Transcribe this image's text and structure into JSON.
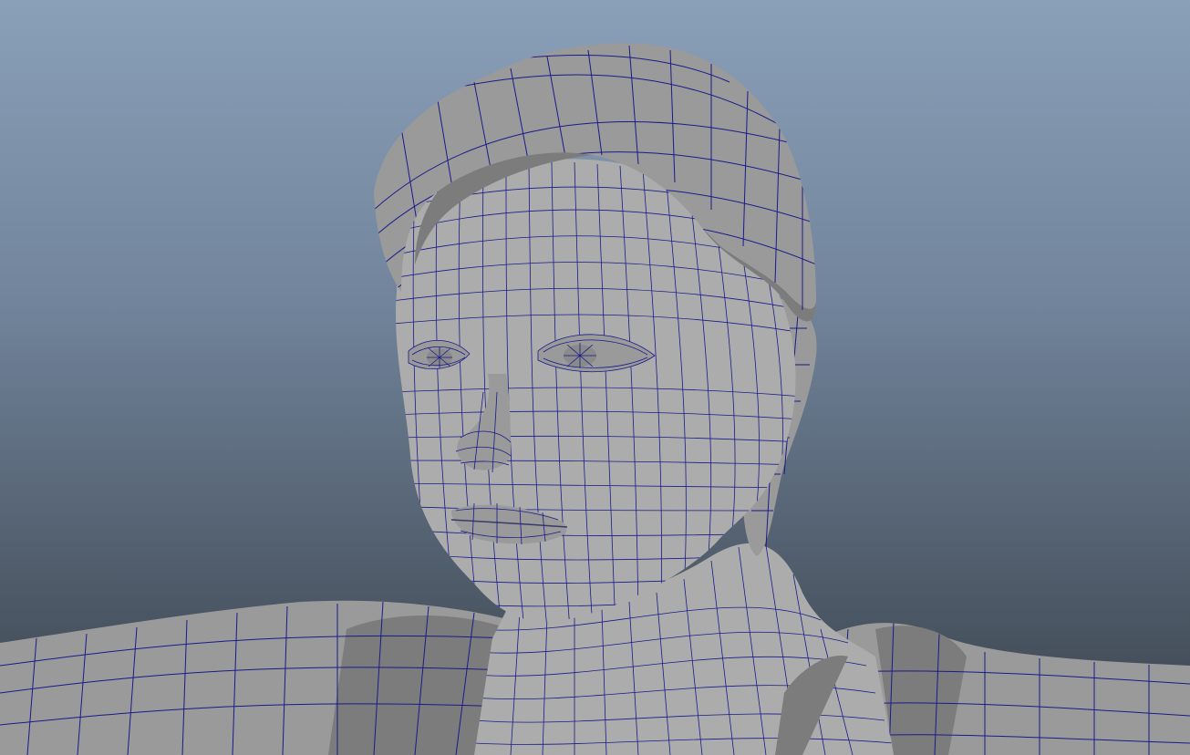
{
  "viewport": {
    "kind": "3d-perspective-viewport",
    "display_mode": "wireframe-on-shaded",
    "background_gradient": [
      "#8aa0b8",
      "#3c444e"
    ],
    "wireframe_color": "#1a1a8c",
    "surface_color": "#9a9a9a"
  },
  "scene": {
    "model": "character-head-and-shoulders-mesh"
  }
}
